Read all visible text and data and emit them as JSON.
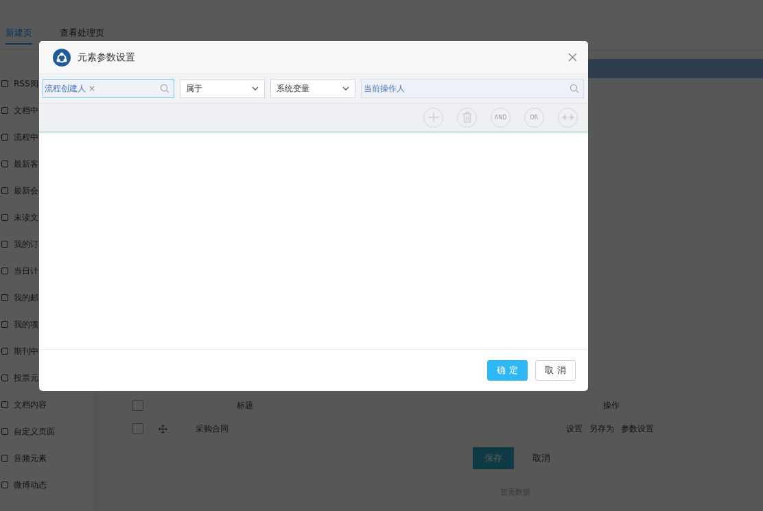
{
  "page_tabs": [
    {
      "label": "新建页",
      "selected": true
    },
    {
      "label": "查看处理页",
      "selected": false
    }
  ],
  "sidebar": {
    "items": [
      {
        "label": "RSS阅"
      },
      {
        "label": "文档中"
      },
      {
        "label": "流程中"
      },
      {
        "label": "最新客"
      },
      {
        "label": "最新会"
      },
      {
        "label": "未读文"
      },
      {
        "label": "我的订"
      },
      {
        "label": "当日计"
      },
      {
        "label": "我的邮"
      },
      {
        "label": "我的项"
      },
      {
        "label": "期刊中"
      },
      {
        "label": "投票元"
      },
      {
        "label": "文档内容"
      },
      {
        "label": "自定义页面"
      },
      {
        "label": "音频元素"
      },
      {
        "label": "微博动态"
      }
    ]
  },
  "table": {
    "header_checked": false,
    "columns": [
      "标题",
      "操作"
    ],
    "rows": [
      {
        "checked": false,
        "title": "采购合同",
        "actions": [
          "设置",
          "另存为",
          "参数设置"
        ]
      }
    ]
  },
  "form_buttons": [
    {
      "label": "保存",
      "kind": "primary"
    },
    {
      "label": "取消",
      "kind": "plain"
    }
  ],
  "empty_text": "暂无数据",
  "dialog": {
    "title": "元素参数设置",
    "field_tag": "流程创建人",
    "field_tag_remove": "×",
    "operator": "属于",
    "value_type": "系统变量",
    "value": "当前操作人",
    "toolbar_buttons": [
      {
        "kind": "plus"
      },
      {
        "kind": "trash"
      },
      {
        "kind": "text",
        "label": "AND"
      },
      {
        "kind": "text",
        "label": "OR"
      },
      {
        "kind": "arrows"
      }
    ],
    "buttons": [
      {
        "label": "确 定",
        "kind": "primary"
      },
      {
        "label": "取 消",
        "kind": "plain"
      }
    ]
  }
}
